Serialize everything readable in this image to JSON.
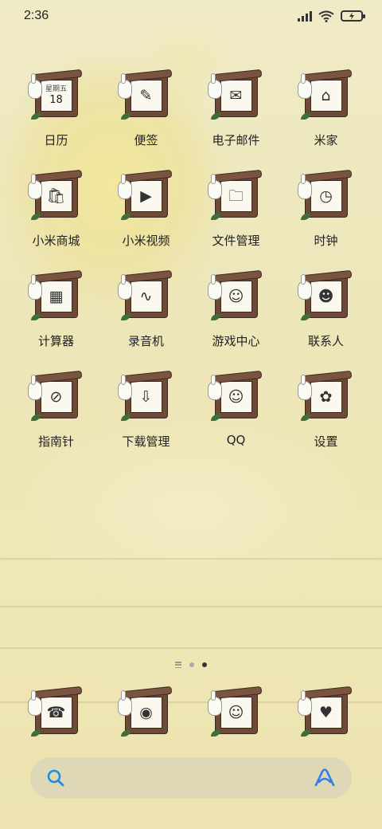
{
  "status_bar": {
    "time": "2:36"
  },
  "calendar_badge": {
    "weekday": "星期五",
    "day": "18"
  },
  "apps": [
    {
      "label": "日历",
      "icon": "calendar-icon",
      "glyph": ""
    },
    {
      "label": "便签",
      "icon": "notes-icon",
      "glyph": "✎"
    },
    {
      "label": "电子邮件",
      "icon": "email-icon",
      "glyph": "✉"
    },
    {
      "label": "米家",
      "icon": "mi-home-icon",
      "glyph": "⌂"
    },
    {
      "label": "小米商城",
      "icon": "mi-store-icon",
      "glyph": "🛍"
    },
    {
      "label": "小米视频",
      "icon": "mi-video-icon",
      "glyph": "▶"
    },
    {
      "label": "文件管理",
      "icon": "file-manager-icon",
      "glyph": "🗀"
    },
    {
      "label": "时钟",
      "icon": "clock-icon",
      "glyph": "◷"
    },
    {
      "label": "计算器",
      "icon": "calculator-icon",
      "glyph": "▦"
    },
    {
      "label": "录音机",
      "icon": "recorder-icon",
      "glyph": "∿"
    },
    {
      "label": "游戏中心",
      "icon": "game-center-icon",
      "glyph": "☺"
    },
    {
      "label": "联系人",
      "icon": "contacts-icon",
      "glyph": "☻"
    },
    {
      "label": "指南针",
      "icon": "compass-icon",
      "glyph": "⊘"
    },
    {
      "label": "下载管理",
      "icon": "download-icon",
      "glyph": "⇩"
    },
    {
      "label": "QQ",
      "icon": "qq-icon",
      "glyph": "☺"
    },
    {
      "label": "设置",
      "icon": "settings-icon",
      "glyph": "✿"
    }
  ],
  "dock": [
    {
      "icon": "phone-icon",
      "glyph": "☎"
    },
    {
      "icon": "messages-icon",
      "glyph": "◉"
    },
    {
      "icon": "browser-icon",
      "glyph": "☺"
    },
    {
      "icon": "gallery-icon",
      "glyph": "♥"
    }
  ],
  "colors": {
    "frame_wood": "#6e4a36",
    "search_icon": "#1e8fe0",
    "assistant_icon": "#2a7fe8"
  }
}
